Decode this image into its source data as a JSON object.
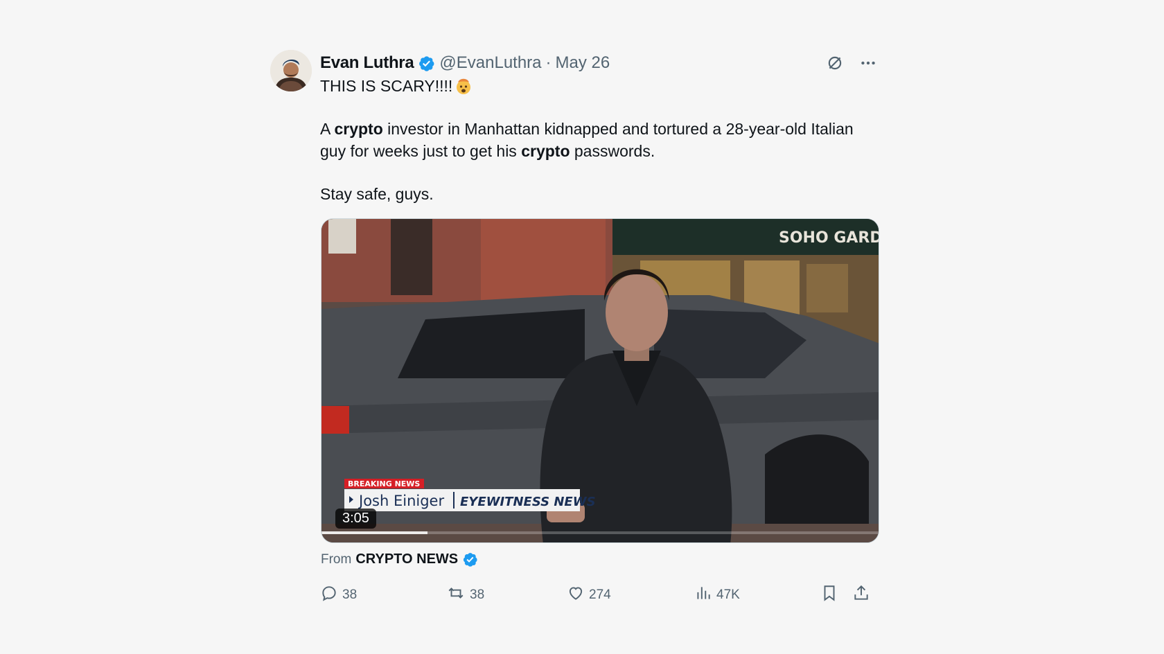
{
  "tweet": {
    "author_name": "Evan Luthra",
    "author_handle": "@EvanLuthra",
    "separator": "·",
    "date": "May 26",
    "line1": "THIS IS SCARY!!!!",
    "p2_a": "A ",
    "p2_b": "crypto",
    "p2_c": " investor in Manhattan kidnapped and tortured a 28-year-old Italian guy for weeks just to get his ",
    "p2_d": "crypto",
    "p2_e": " passwords.",
    "p3": "Stay safe, guys."
  },
  "media": {
    "duration": "3:05",
    "progress": 0.19,
    "lower_third_tag": "BREAKING NEWS",
    "lower_third_name": "Josh Einiger",
    "lower_third_brand": "EYEWITNESS NEWS",
    "storefront_sign": "SOHO GARDE"
  },
  "source": {
    "prefix": "From",
    "name": "CRYPTO NEWS"
  },
  "stats": {
    "replies": "38",
    "reposts": "38",
    "likes": "274",
    "views": "47K"
  },
  "colors": {
    "verified": "#1d9bf0",
    "secondary_text": "#536471",
    "breaking_red": "#d61f26"
  },
  "icons": {
    "grok": "grok-icon",
    "more": "more-icon",
    "reply": "reply-icon",
    "retweet": "retweet-icon",
    "like": "heart-icon",
    "views": "views-icon",
    "bookmark": "bookmark-icon",
    "share": "share-icon"
  }
}
